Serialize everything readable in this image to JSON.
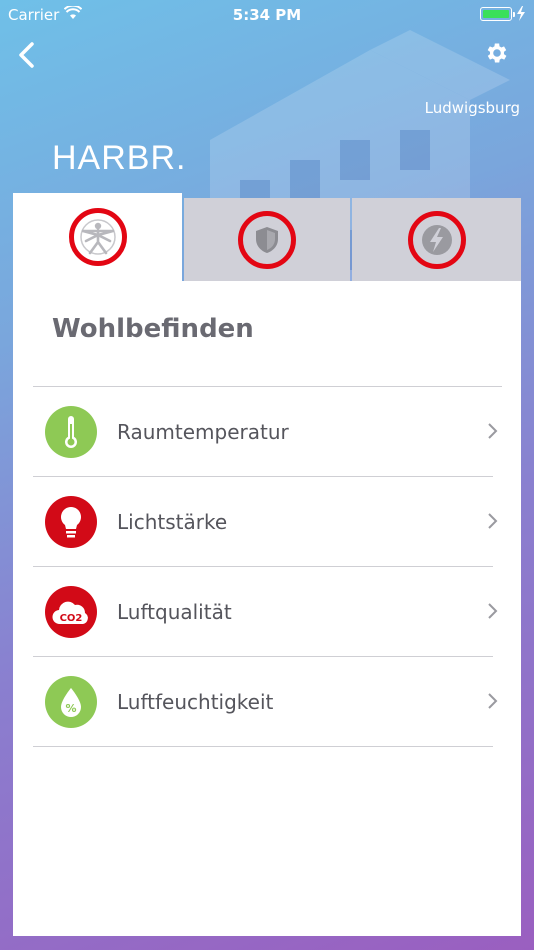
{
  "status_bar": {
    "carrier": "Carrier",
    "time": "5:34 PM"
  },
  "header": {
    "location": "Ludwigsburg",
    "logo": "HARBR."
  },
  "tabs": [
    {
      "icon": "person-icon",
      "active": true
    },
    {
      "icon": "shield-icon",
      "active": false
    },
    {
      "icon": "lightning-icon",
      "active": false
    }
  ],
  "panel": {
    "title": "Wohlbefinden",
    "items": [
      {
        "label": "Raumtemperatur",
        "icon": "thermometer-icon",
        "color": "#8ec955"
      },
      {
        "label": "Lichtstärke",
        "icon": "lightbulb-icon",
        "color": "#d20a17"
      },
      {
        "label": "Luftqualität",
        "icon": "co2-cloud-icon",
        "color": "#d20a17",
        "icon_text": "CO2"
      },
      {
        "label": "Luftfeuchtigkeit",
        "icon": "humidity-drop-icon",
        "color": "#8ec955",
        "icon_text": "%"
      }
    ]
  },
  "colors": {
    "accent_red": "#e30613",
    "green": "#8ec955",
    "red": "#d20a17"
  }
}
